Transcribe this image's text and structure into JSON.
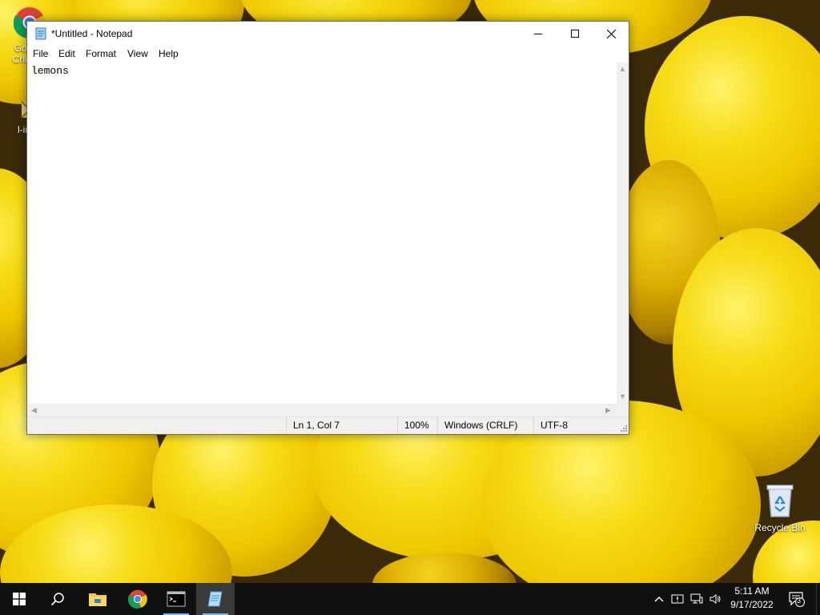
{
  "desktop": {
    "icons": [
      {
        "label": "Google Chrome",
        "icon": "chrome-icon"
      },
      {
        "label": "l-intro",
        "icon": "file-icon"
      },
      {
        "label": "Recycle Bin",
        "icon": "recycle-bin-icon"
      }
    ],
    "wallpaper": "lemons"
  },
  "notepad": {
    "title": "*Untitled - Notepad",
    "menu": [
      "File",
      "Edit",
      "Format",
      "View",
      "Help"
    ],
    "content": "lemons",
    "status": {
      "position": "Ln 1, Col 7",
      "zoom": "100%",
      "line_endings": "Windows (CRLF)",
      "encoding": "UTF-8"
    },
    "controls": [
      "minimize-icon",
      "maximize-icon",
      "close-icon"
    ]
  },
  "taskbar": {
    "items": [
      "start-icon",
      "search-icon",
      "file-explorer-icon",
      "chrome-icon",
      "terminal-icon",
      "notepad-icon"
    ],
    "tray": {
      "time": "5:11 AM",
      "date": "9/17/2022",
      "notifications": "3"
    }
  },
  "colors": {
    "taskbar": "#101010",
    "accent": "#76b9ed",
    "close_hover": "#e81123"
  }
}
